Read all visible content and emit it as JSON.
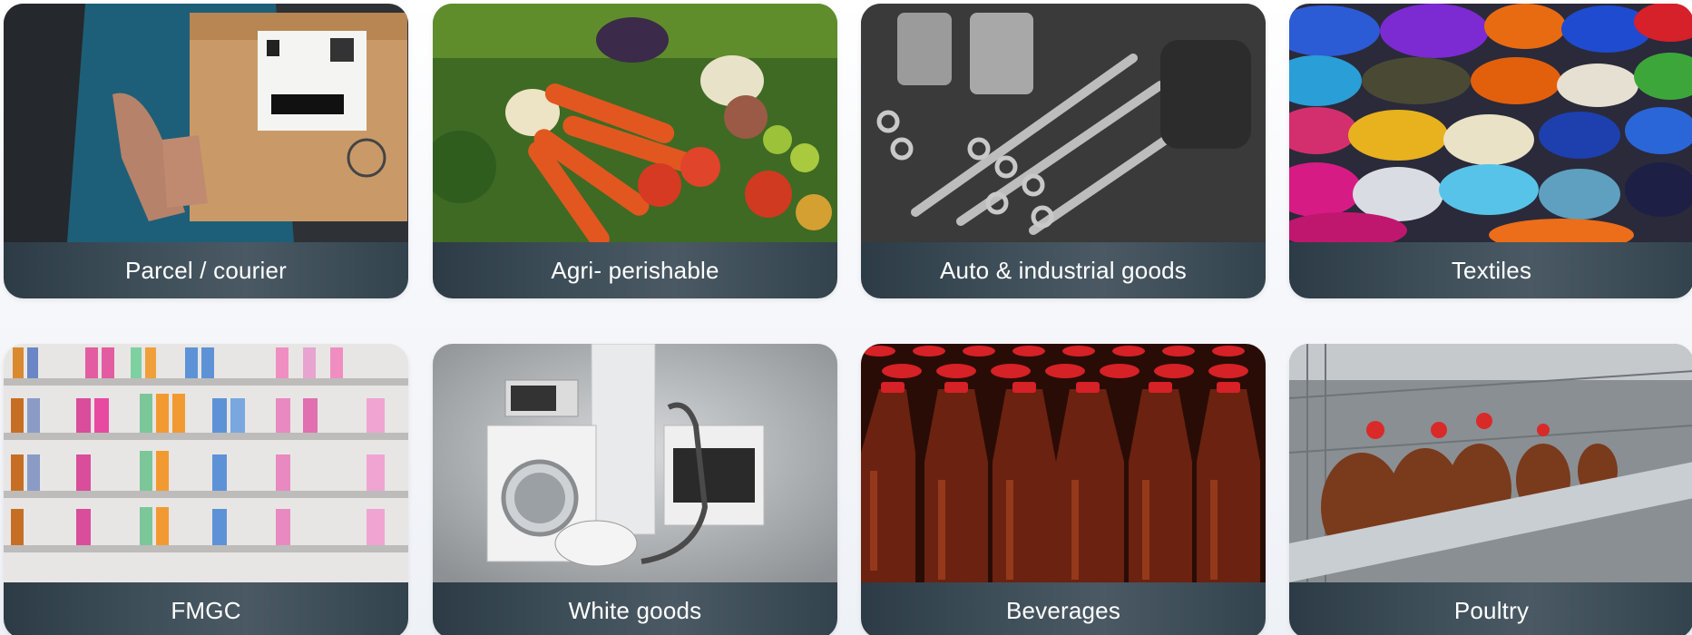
{
  "cards": [
    {
      "label": "Parcel / courier",
      "image": "person-holding-cardboard-box-photo"
    },
    {
      "label": "Agri- perishable",
      "image": "fresh-vegetables-photo"
    },
    {
      "label": "Auto & industrial goods",
      "image": "engine-parts-photo"
    },
    {
      "label": "Textiles",
      "image": "fabric-rolls-photo"
    },
    {
      "label": "FMGC",
      "image": "store-shelves-bottles-photo"
    },
    {
      "label": "White goods",
      "image": "home-appliances-photo"
    },
    {
      "label": "Beverages",
      "image": "soda-bottles-photo"
    },
    {
      "label": "Poultry",
      "image": "hens-in-cages-photo"
    }
  ],
  "colors": {
    "caption_bg": "#3f4f59",
    "caption_text": "#ffffff",
    "page_bg": "#f7f8fb"
  }
}
